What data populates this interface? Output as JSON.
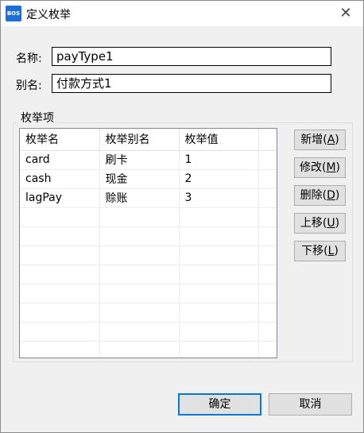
{
  "window": {
    "title": "定义枚举",
    "icon_text": "BOS"
  },
  "form": {
    "name_label": "名称:",
    "name_value": "payType1",
    "alias_label": "别名:",
    "alias_value": "付款方式1"
  },
  "group": {
    "title": "枚举项"
  },
  "table": {
    "columns": [
      "枚举名",
      "枚举别名",
      "枚举值"
    ],
    "rows": [
      [
        "card",
        "刷卡",
        "1"
      ],
      [
        "cash",
        "现金",
        "2"
      ],
      [
        "lagPay",
        "赊账",
        "3"
      ]
    ]
  },
  "buttons": {
    "add": {
      "label": "新增(",
      "key": "A",
      "tail": ")"
    },
    "modify": {
      "label": "修改(",
      "key": "M",
      "tail": ")"
    },
    "delete": {
      "label": "删除(",
      "key": "D",
      "tail": ")"
    },
    "up": {
      "label": "上移(",
      "key": "U",
      "tail": ")"
    },
    "down": {
      "label": "下移(",
      "key": "L",
      "tail": ")"
    },
    "ok": "确定",
    "cancel": "取消"
  },
  "icons": {
    "close": "close-icon"
  }
}
